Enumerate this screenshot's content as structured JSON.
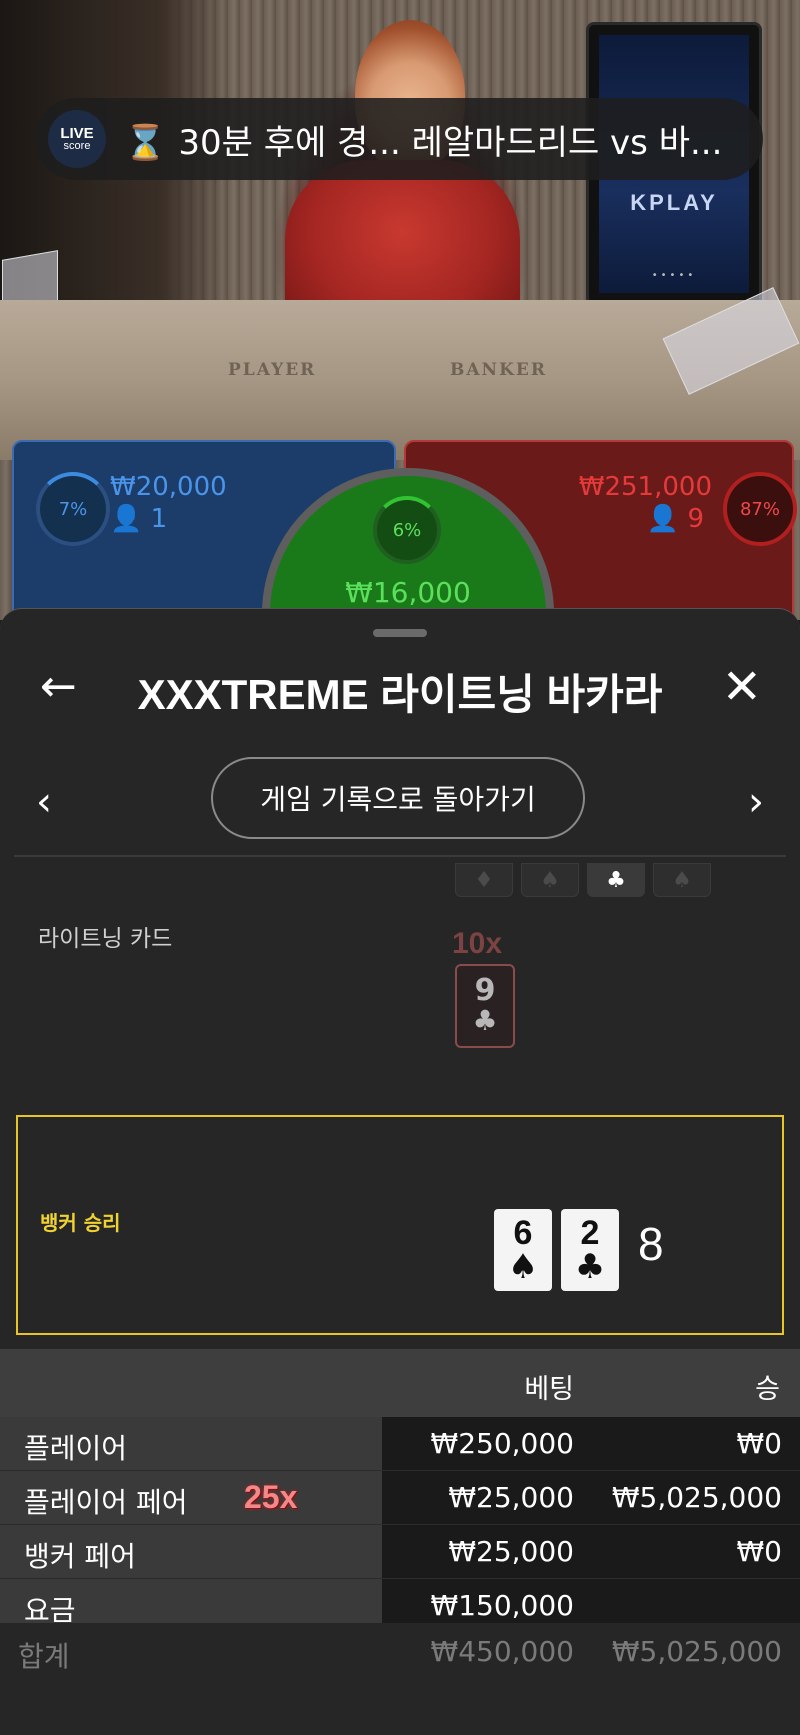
{
  "live_score": {
    "logo_line1": "LIVE",
    "logo_line2": "score",
    "icon": "hourglass-icon",
    "text": "30분 후에 경... 레알마드리드 vs 바..."
  },
  "video": {
    "monitor_logo": "KPLAY",
    "monitor_dots": "•••••",
    "felt_player": "PLAYER",
    "felt_banker": "BANKER"
  },
  "spots": {
    "player": {
      "percent": "7%",
      "amount": "₩20,000",
      "count": "1"
    },
    "tie": {
      "percent": "6%",
      "amount": "₩16,000"
    },
    "banker": {
      "percent": "87%",
      "amount": "₩251,000",
      "count": "9"
    }
  },
  "sheet": {
    "title": "XXXTREME 라이트닝 바카라",
    "back_to_history": "게임 기록으로 돌아가기",
    "lightning_label": "라이트닝 카드",
    "lightning_multiplier": "10x",
    "lightning_card": {
      "rank": "9",
      "suit": "♣"
    },
    "suit_tabs": [
      "♦",
      "♠",
      "♣",
      "♠"
    ],
    "result_label": "뱅커 승리",
    "result_cards": [
      {
        "rank": "6",
        "suit": "♠"
      },
      {
        "rank": "2",
        "suit": "♣"
      }
    ],
    "result_score": "8"
  },
  "bets": {
    "header_bet": "베팅",
    "header_win": "승",
    "rows": [
      {
        "name": "플레이어",
        "bet": "₩250,000",
        "win": "₩0",
        "multiplier": ""
      },
      {
        "name": "플레이어 페어",
        "bet": "₩25,000",
        "win": "₩5,025,000",
        "multiplier": "25x"
      },
      {
        "name": "뱅커 페어",
        "bet": "₩25,000",
        "win": "₩0",
        "multiplier": ""
      },
      {
        "name": "요금",
        "bet": "₩150,000",
        "win": "",
        "multiplier": ""
      }
    ],
    "total": {
      "name": "합계",
      "bet": "₩450,000",
      "win": "₩5,025,000"
    }
  },
  "colors": {
    "player": "#4a95ea",
    "banker": "#e63a3a",
    "tie": "#5be05b",
    "result_border": "#e6c626",
    "multiplier": "#f08a8a"
  }
}
